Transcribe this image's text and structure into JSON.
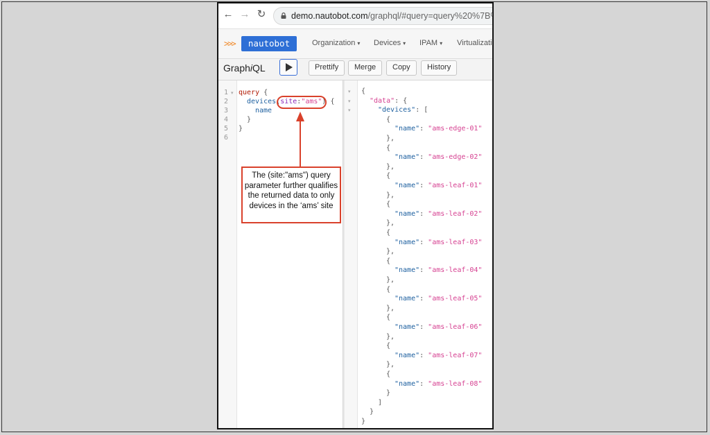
{
  "browser": {
    "back_glyph": "←",
    "forward_glyph": "→",
    "reload_glyph": "↻",
    "url_host": "demo.nautobot.com",
    "url_rest": "/graphql/#query=query%20%7B%0A%"
  },
  "app_nav": {
    "logo_chevrons": ">>>",
    "logo_text": "nautobot",
    "menus": [
      {
        "label": "Organization"
      },
      {
        "label": "Devices"
      },
      {
        "label": "IPAM"
      },
      {
        "label": "Virtualizati"
      }
    ],
    "caret": "▾"
  },
  "graphiql": {
    "title_prefix": "Graph",
    "title_italic": "i",
    "title_suffix": "QL",
    "buttons": {
      "prettify": "Prettify",
      "merge": "Merge",
      "copy": "Copy",
      "history": "History"
    }
  },
  "query_editor": {
    "line_numbers": [
      "1",
      "2",
      "3",
      "4",
      "5",
      "6"
    ],
    "fold_glyph": "▾",
    "line1": {
      "kw": "query",
      "brace": " {"
    },
    "line2": {
      "field": "devices",
      "open": "(",
      "arg": "site",
      "colon": ":",
      "val": "\"ams\"",
      "close": ")",
      "brace": " {"
    },
    "line3": {
      "field": "name"
    },
    "line4": "}",
    "line5": "}"
  },
  "annotation": {
    "callout_text": "The (site:\"ams\") query parameter further qualifies the returned data to only devices in the ‘ams’ site",
    "color": "#d9412b"
  },
  "result": {
    "open_brace": "{",
    "data_key": "\"data\"",
    "devices_key": "\"devices\"",
    "name_key": "\"name\"",
    "devices": [
      "\"ams-edge-01\"",
      "\"ams-edge-02\"",
      "\"ams-leaf-01\"",
      "\"ams-leaf-02\"",
      "\"ams-leaf-03\"",
      "\"ams-leaf-04\"",
      "\"ams-leaf-05\"",
      "\"ams-leaf-06\"",
      "\"ams-leaf-07\"",
      "\"ams-leaf-08\""
    ],
    "close_array": "]",
    "close_data": "}",
    "close_root": "}"
  }
}
